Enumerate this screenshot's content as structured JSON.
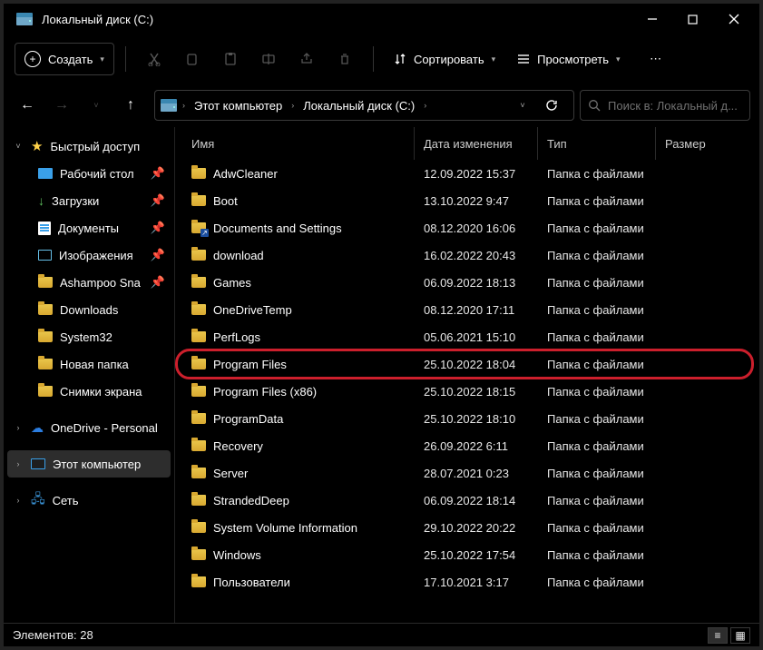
{
  "title": "Локальный диск (C:)",
  "toolbar": {
    "create": "Создать",
    "sort": "Сортировать",
    "view": "Просмотреть"
  },
  "breadcrumb": [
    "Этот компьютер",
    "Локальный диск (C:)"
  ],
  "search_placeholder": "Поиск в: Локальный д...",
  "columns": {
    "name": "Имя",
    "date": "Дата изменения",
    "type": "Тип",
    "size": "Размер"
  },
  "sidebar": {
    "quick": "Быстрый доступ",
    "desktop": "Рабочий стол",
    "downloads": "Загрузки",
    "documents": "Документы",
    "pictures": "Изображения",
    "ashampoo": "Ashampoo Sna",
    "downloads2": "Downloads",
    "system32": "System32",
    "newfolder": "Новая папка",
    "screenshots": "Снимки экрана",
    "onedrive": "OneDrive - Personal",
    "thispc": "Этот компьютер",
    "network": "Сеть"
  },
  "rows": [
    {
      "name": "AdwCleaner",
      "date": "12.09.2022 15:37",
      "type": "Папка с файлами",
      "link": false
    },
    {
      "name": "Boot",
      "date": "13.10.2022 9:47",
      "type": "Папка с файлами",
      "link": false
    },
    {
      "name": "Documents and Settings",
      "date": "08.12.2020 16:06",
      "type": "Папка с файлами",
      "link": true
    },
    {
      "name": "download",
      "date": "16.02.2022 20:43",
      "type": "Папка с файлами",
      "link": false
    },
    {
      "name": "Games",
      "date": "06.09.2022 18:13",
      "type": "Папка с файлами",
      "link": false
    },
    {
      "name": "OneDriveTemp",
      "date": "08.12.2020 17:11",
      "type": "Папка с файлами",
      "link": false
    },
    {
      "name": "PerfLogs",
      "date": "05.06.2021 15:10",
      "type": "Папка с файлами",
      "link": false
    },
    {
      "name": "Program Files",
      "date": "25.10.2022 18:04",
      "type": "Папка с файлами",
      "link": false,
      "highlight": true
    },
    {
      "name": "Program Files (x86)",
      "date": "25.10.2022 18:15",
      "type": "Папка с файлами",
      "link": false
    },
    {
      "name": "ProgramData",
      "date": "25.10.2022 18:10",
      "type": "Папка с файлами",
      "link": false
    },
    {
      "name": "Recovery",
      "date": "26.09.2022 6:11",
      "type": "Папка с файлами",
      "link": false
    },
    {
      "name": "Server",
      "date": "28.07.2021 0:23",
      "type": "Папка с файлами",
      "link": false
    },
    {
      "name": "StrandedDeep",
      "date": "06.09.2022 18:14",
      "type": "Папка с файлами",
      "link": false
    },
    {
      "name": "System Volume Information",
      "date": "29.10.2022 20:22",
      "type": "Папка с файлами",
      "link": false
    },
    {
      "name": "Windows",
      "date": "25.10.2022 17:54",
      "type": "Папка с файлами",
      "link": false
    },
    {
      "name": "Пользователи",
      "date": "17.10.2021 3:17",
      "type": "Папка с файлами",
      "link": false
    }
  ],
  "status": "Элементов: 28"
}
